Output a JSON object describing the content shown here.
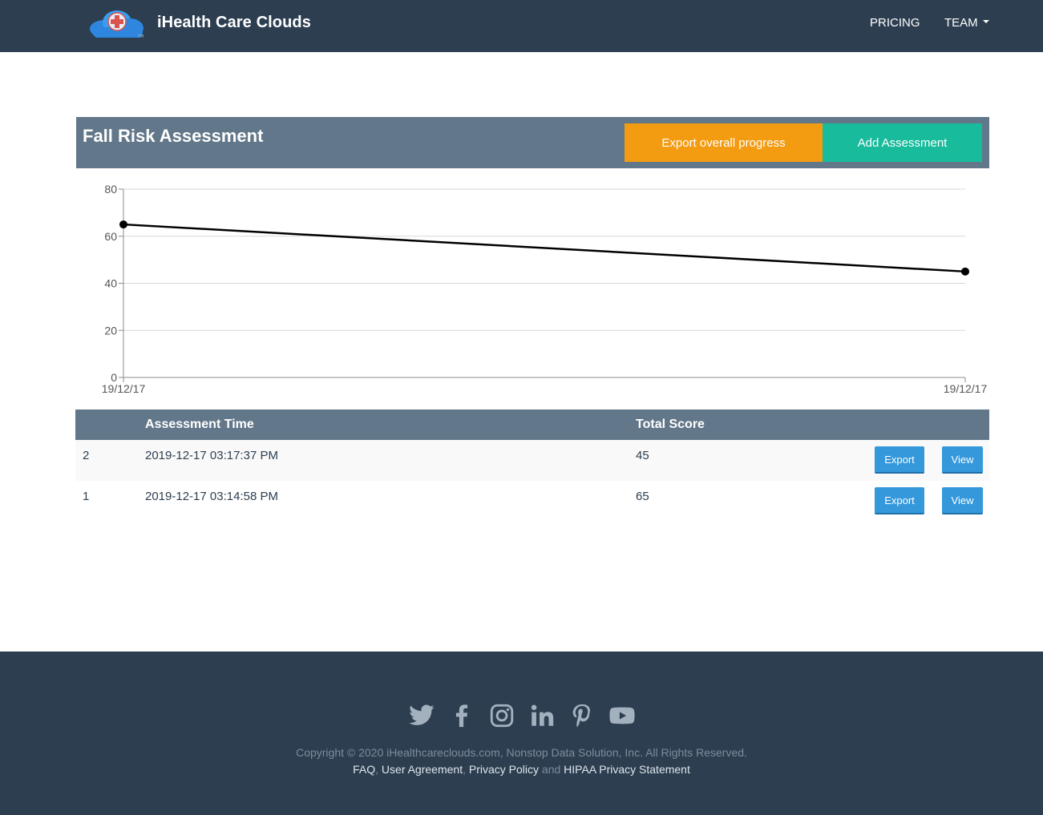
{
  "navbar": {
    "brand": "iHealth Care Clouds",
    "items": [
      {
        "label": "PRICING"
      },
      {
        "label": "TEAM"
      }
    ]
  },
  "panel": {
    "title": "Fall Risk Assessment",
    "export_label": "Export overall progress",
    "add_label": "Add Assessment"
  },
  "colors": {
    "navbar": "#2c3e50",
    "panel_header": "#62778a",
    "export_progress": "#f39c12",
    "add_assessment": "#18bc9c",
    "row_button": "#3498db"
  },
  "chart_data": {
    "type": "line",
    "x": [
      "19/12/17",
      "19/12/17"
    ],
    "series": [
      {
        "values": [
          65,
          45
        ]
      }
    ],
    "ylim": [
      0,
      80
    ],
    "yticks": [
      0,
      20,
      40,
      60,
      80
    ],
    "grid": true
  },
  "table": {
    "columns": [
      "",
      "Assessment Time",
      "Total Score"
    ],
    "rows": [
      {
        "num": "2",
        "time": "2019-12-17 03:17:37 PM",
        "score": "45",
        "export": "Export",
        "view": "View"
      },
      {
        "num": "1",
        "time": "2019-12-17 03:14:58 PM",
        "score": "65",
        "export": "Export",
        "view": "View"
      }
    ]
  },
  "footer": {
    "socials": [
      "twitter-icon",
      "facebook-icon",
      "instagram-icon",
      "linkedin-icon",
      "pinterest-icon",
      "youtube-icon"
    ],
    "copyright": "Copyright © 2020 iHealthcareclouds.com, Nonstop Data Solution, Inc. All Rights Reserved.",
    "links": {
      "faq": "FAQ",
      "sep1": ", ",
      "agreement": "User Agreement",
      "sep2": ", ",
      "privacy": "Privacy Policy",
      "and": " and ",
      "hipaa": "HIPAA Privacy Statement"
    }
  }
}
